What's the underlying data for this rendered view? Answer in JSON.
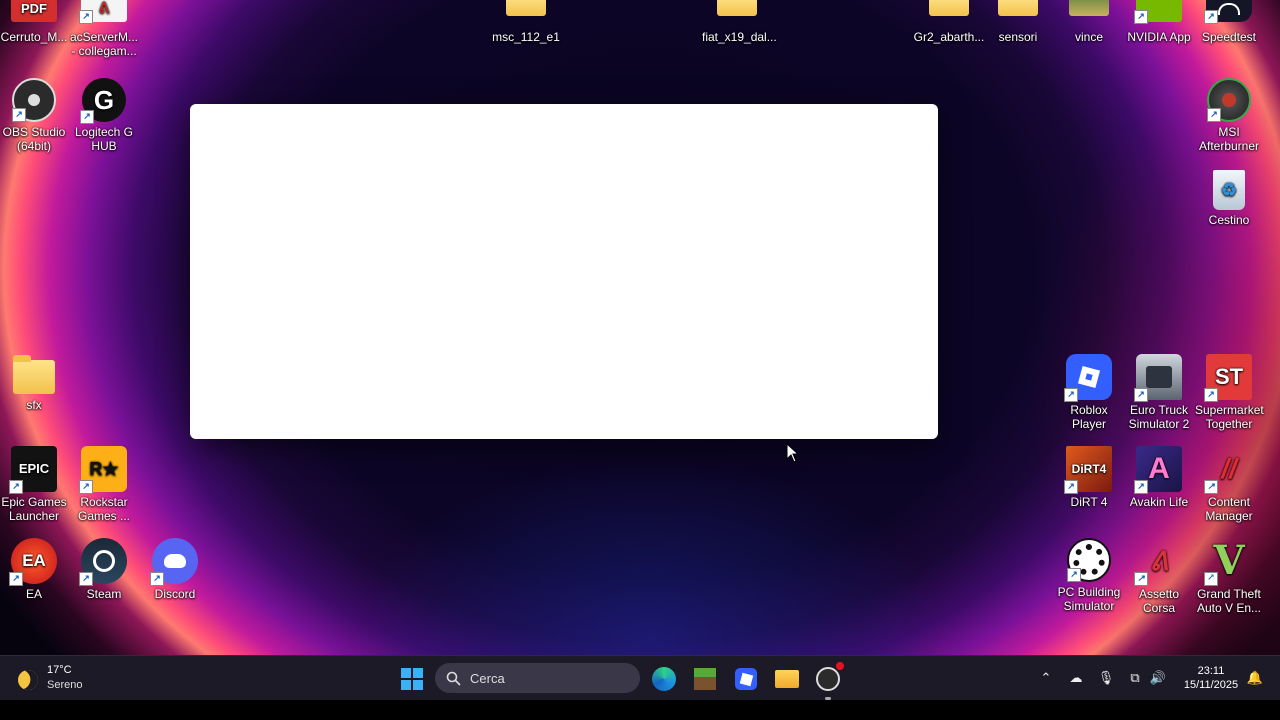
{
  "desktop": {
    "top_folders": [
      {
        "label": "msc_112_e1"
      },
      {
        "label": "fiat_x19_dal..."
      },
      {
        "label": "Gr2_abarth..."
      },
      {
        "label": "sensori"
      },
      {
        "label": "vince"
      }
    ],
    "icons": {
      "cerruto": {
        "line1": "Cerruto_M...",
        "glyph": "PDF"
      },
      "acserver": {
        "line1": "acServerM...",
        "line2": "- collegam..."
      },
      "obs": {
        "line1": "OBS Studio",
        "line2": "(64bit)"
      },
      "logitech": {
        "line1": "Logitech G",
        "line2": "HUB",
        "glyph": "G"
      },
      "sfx": {
        "line1": "sfx"
      },
      "epic": {
        "line1": "Epic Games",
        "line2": "Launcher",
        "glyph": "EPIC"
      },
      "rockstar": {
        "line1": "Rockstar",
        "line2": "Games ...",
        "glyph": "R★"
      },
      "ea": {
        "line1": "EA",
        "glyph": "EA"
      },
      "steam": {
        "line1": "Steam"
      },
      "discord": {
        "line1": "Discord"
      },
      "nvidia": {
        "line1": "NVIDIA App"
      },
      "speedtest": {
        "line1": "Speedtest"
      },
      "msi": {
        "line1": "MSI",
        "line2": "Afterburner"
      },
      "recycle": {
        "line1": "Cestino"
      },
      "roblox": {
        "line1": "Roblox Player"
      },
      "eurotruck": {
        "line1": "Euro Truck",
        "line2": "Simulator 2"
      },
      "supermarket": {
        "line1": "Supermarket",
        "line2": "Together",
        "glyph": "ST"
      },
      "dirt": {
        "line1": "DiRT 4",
        "glyph": "DiRT4"
      },
      "avakin": {
        "line1": "Avakin Life",
        "glyph": "A"
      },
      "contentmanager": {
        "line1": "Content",
        "line2": "Manager"
      },
      "pcbuilding": {
        "line1": "PC Building",
        "line2": "Simulator"
      },
      "assetto": {
        "line1": "Assetto",
        "line2": "Corsa"
      },
      "gta": {
        "line1": "Grand Theft",
        "line2": "Auto V En...",
        "glyph": "V"
      }
    }
  },
  "taskbar": {
    "weather": {
      "temp": "17°C",
      "condition": "Sereno"
    },
    "search": {
      "placeholder": "Cerca"
    },
    "clock": {
      "time": "23:11",
      "date": "15/11/2025"
    },
    "pinned": [
      "start-icon",
      "edge-icon",
      "minecraft-icon",
      "roblox-icon",
      "file-explorer-icon",
      "obs-icon"
    ],
    "tray": [
      "chevron-up-icon",
      "onedrive-icon",
      "microphone-icon",
      "network-icon",
      "volume-icon",
      "notification-icon"
    ]
  },
  "colors": {
    "taskbar_bg": "#1c1a26",
    "dialog_bg": "#ffffff",
    "accent_blue": "#0078d4"
  }
}
